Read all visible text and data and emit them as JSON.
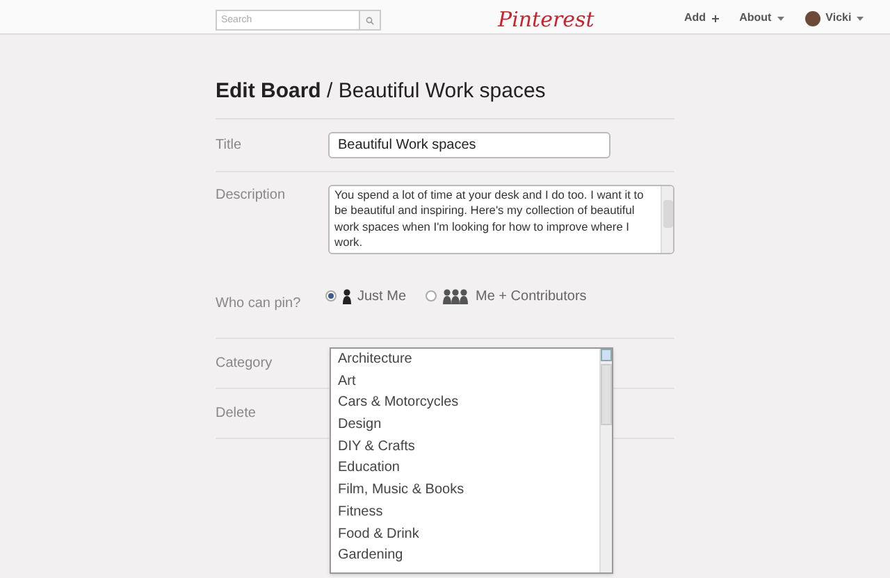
{
  "header": {
    "search": {
      "placeholder": "Search"
    },
    "logo": "Pinterest",
    "nav": [
      {
        "label": "Add",
        "kind": "plus"
      },
      {
        "label": "About",
        "kind": "caret"
      },
      {
        "label": "Vicki",
        "kind": "user"
      }
    ]
  },
  "heading": {
    "section": "Edit Board",
    "separator": "/",
    "board": "Beautiful Work spaces"
  },
  "form": {
    "title": {
      "label": "Title",
      "value": "Beautiful Work spaces"
    },
    "description": {
      "label": "Description",
      "value": "You spend a lot of time at your desk and I do too. I want it to be beautiful and inspiring. Here's my collection of beautiful work spaces when I'm looking for how to improve where I work."
    },
    "who_can_pin": {
      "label": "Who can pin?",
      "options": [
        {
          "label": "Just Me",
          "kind": "single",
          "selected": true
        },
        {
          "label": "Me + Contributors",
          "kind": "group",
          "selected": false
        }
      ]
    },
    "category": {
      "label": "Category",
      "options": [
        "Architecture",
        "Art",
        "Cars & Motorcycles",
        "Design",
        "DIY & Crafts",
        "Education",
        "Film, Music & Books",
        "Fitness",
        "Food & Drink",
        "Gardening"
      ]
    },
    "delete": {
      "label": "Delete"
    }
  }
}
